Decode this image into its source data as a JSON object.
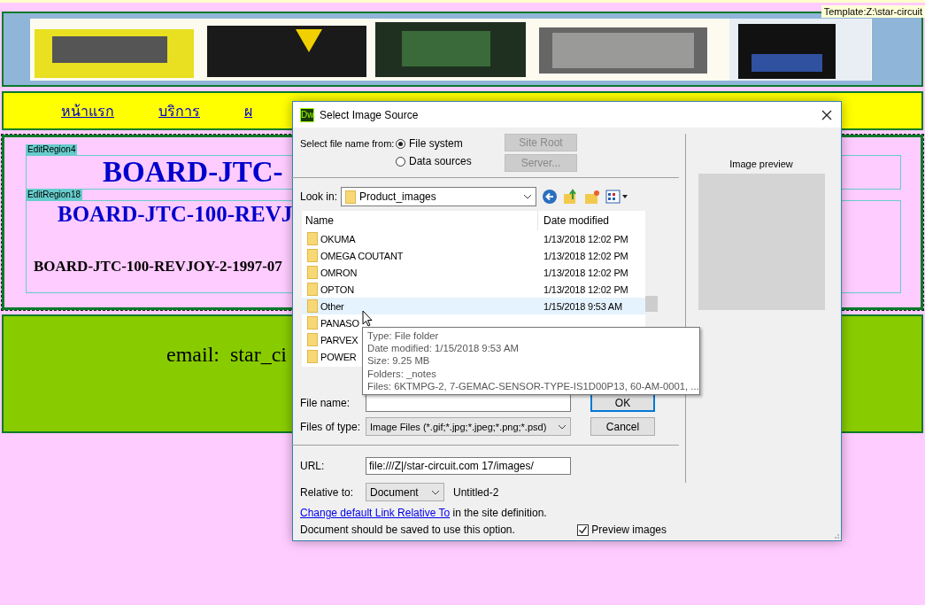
{
  "template_label": "Template:Z:\\star-circuit",
  "nav": [
    {
      "label": "หน้าแรก"
    },
    {
      "label": "บริการ"
    },
    {
      "label": "ผ"
    }
  ],
  "edit_regions": [
    {
      "tag": "EditRegion4",
      "heading": "BOARD-JTC-"
    },
    {
      "tag": "EditRegion18",
      "heading": "BOARD-JTC-100-REVJ",
      "subheading": "BOARD-JTC-100-REVJOY-2-1997-07"
    }
  ],
  "contact": "email:  star_ci",
  "dialog": {
    "app_icon": "Dw",
    "title": "Select Image Source",
    "source": {
      "label": "Select file name from:",
      "options": [
        {
          "label": "File system",
          "selected": true
        },
        {
          "label": "Data sources",
          "selected": false
        }
      ],
      "buttons": [
        {
          "label": "Site Root",
          "disabled": true
        },
        {
          "label": "Server...",
          "disabled": true
        }
      ]
    },
    "look_in": {
      "label": "Look in:",
      "value": "Product_images"
    },
    "columns": [
      "Name",
      "Date modified"
    ],
    "rows": [
      {
        "name": "OKUMA",
        "date": "1/13/2018 12:02 PM",
        "selected": false
      },
      {
        "name": "OMEGA COUTANT",
        "date": "1/13/2018 12:02 PM",
        "selected": false
      },
      {
        "name": "OMRON",
        "date": "1/13/2018 12:02 PM",
        "selected": false
      },
      {
        "name": "OPTON",
        "date": "1/13/2018 12:02 PM",
        "selected": false
      },
      {
        "name": "Other",
        "date": "1/15/2018 9:53 AM",
        "selected": true
      },
      {
        "name": "PANASO",
        "selected": false
      },
      {
        "name": "PARVEX",
        "selected": false
      },
      {
        "name": "POWER",
        "selected": false
      }
    ],
    "file_name": {
      "label": "File name:"
    },
    "files_of_type": {
      "label": "Files of type:",
      "value": "Image Files (*.gif;*.jpg;*.jpeg;*.png;*.psd)"
    },
    "buttons": [
      {
        "label": "OK",
        "default": true
      },
      {
        "label": "Cancel",
        "default": false
      }
    ],
    "url": {
      "label": "URL:",
      "value": "file:///Z|/star-circuit.com 17/images/"
    },
    "relative_to": {
      "label": "Relative to:",
      "value": "Document",
      "note": "Untitled-2"
    },
    "link_line": {
      "link": "Change default Link Relative To",
      "rest": " in the site definition."
    },
    "note": "Document should be saved to use this option.",
    "preview_images": {
      "label": "Preview images",
      "checked": true
    },
    "preview_label": "Image preview",
    "tooltip": [
      "Type: File folder",
      "Date modified: 1/15/2018 9:53 AM",
      "Size: 9.25 MB",
      "Folders: _notes",
      "Files: 6KTMPG-2, 7-GEMAC-SENSOR-TYPE-IS1D00P13, 60-AM-0001, ..."
    ]
  }
}
